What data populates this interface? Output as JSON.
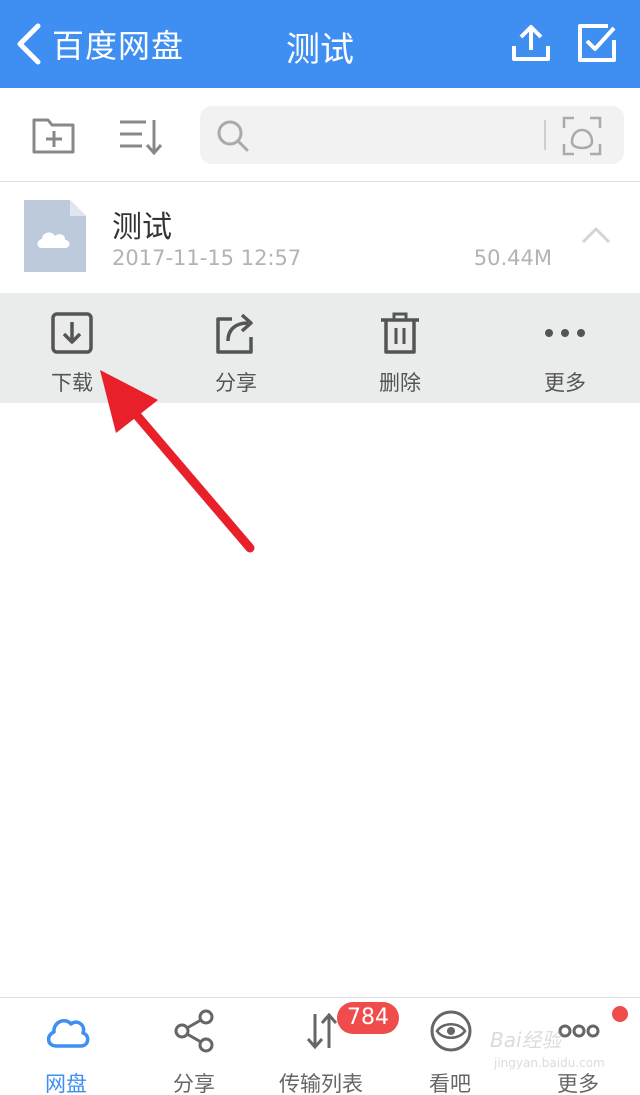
{
  "header": {
    "back_label": "百度网盘",
    "title": "测试",
    "upload_icon": "upload-icon",
    "select_icon": "select-checkbox-icon",
    "background": "#3f8ff3"
  },
  "toolbar": {
    "new_folder_icon": "new-folder-icon",
    "sort_icon": "sort-icon",
    "search_placeholder": "",
    "scan_icon": "face-scan-icon"
  },
  "file": {
    "name": "测试",
    "date": "2017-11-15 12:57",
    "size": "50.44M",
    "icon": "cloud-file-icon"
  },
  "actions": [
    {
      "label": "下载",
      "icon": "download-icon"
    },
    {
      "label": "分享",
      "icon": "share-icon"
    },
    {
      "label": "删除",
      "icon": "trash-icon"
    },
    {
      "label": "更多",
      "icon": "more-icon"
    }
  ],
  "tabs": [
    {
      "label": "网盘",
      "icon": "cloud-icon",
      "active": true
    },
    {
      "label": "分享",
      "icon": "share-nodes-icon"
    },
    {
      "label": "传输列表",
      "icon": "transfer-icon",
      "badge": "784"
    },
    {
      "label": "看吧",
      "icon": "eye-icon"
    },
    {
      "label": "更多",
      "icon": "more-dots-icon"
    }
  ],
  "watermark": {
    "line1": "Bai经验",
    "line2": "jingyan.baidu.com"
  },
  "colors": {
    "accent": "#3f8ff3",
    "badge": "#f14c4c",
    "arrow": "#e8202a"
  }
}
